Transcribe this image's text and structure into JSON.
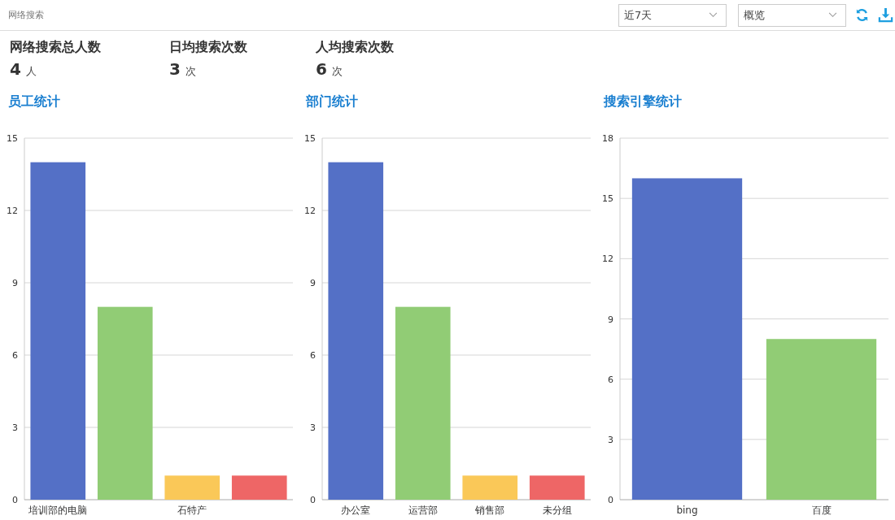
{
  "header": {
    "title": "网络搜索",
    "range_select": "近7天",
    "view_select": "概览"
  },
  "stats": [
    {
      "label": "网络搜索总人数",
      "value": "4",
      "unit": "人"
    },
    {
      "label": "日均搜索次数",
      "value": "3",
      "unit": "次"
    },
    {
      "label": "人均搜索次数",
      "value": "6",
      "unit": "次"
    }
  ],
  "charts": [
    {
      "title": "员工统计",
      "chart_data": {
        "type": "bar",
        "categories": [
          "培训部的电脑",
          null,
          "石特产",
          null
        ],
        "values": [
          14,
          8,
          1,
          1
        ],
        "colors": [
          "#5470c6",
          "#91cc75",
          "#fac858",
          "#ee6666"
        ],
        "ylim": [
          0,
          15
        ],
        "yticks": [
          0,
          3,
          6,
          9,
          12,
          15
        ],
        "grid": true
      }
    },
    {
      "title": "部门统计",
      "chart_data": {
        "type": "bar",
        "categories": [
          "办公室",
          "运营部",
          "销售部",
          "未分组"
        ],
        "values": [
          14,
          8,
          1,
          1
        ],
        "colors": [
          "#5470c6",
          "#91cc75",
          "#fac858",
          "#ee6666"
        ],
        "ylim": [
          0,
          15
        ],
        "yticks": [
          0,
          3,
          6,
          9,
          12,
          15
        ],
        "grid": true
      }
    },
    {
      "title": "搜索引擎统计",
      "chart_data": {
        "type": "bar",
        "categories": [
          "bing",
          "百度"
        ],
        "values": [
          16,
          8
        ],
        "colors": [
          "#5470c6",
          "#91cc75"
        ],
        "ylim": [
          0,
          18
        ],
        "yticks": [
          0,
          3,
          6,
          9,
          12,
          15,
          18
        ],
        "grid": true
      }
    }
  ]
}
